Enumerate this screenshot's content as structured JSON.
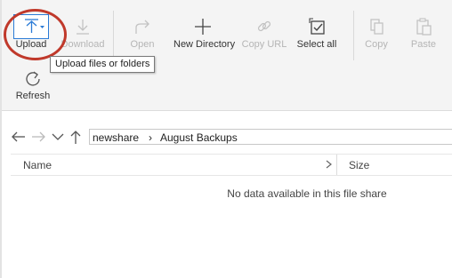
{
  "toolbar": {
    "buttons": [
      {
        "label": "Upload",
        "icon": "upload-icon",
        "enabled": true
      },
      {
        "label": "Download",
        "icon": "download-icon",
        "enabled": false
      },
      {
        "label": "Open",
        "icon": "open-icon",
        "enabled": false
      },
      {
        "label": "New Directory",
        "icon": "plus-icon",
        "enabled": true
      },
      {
        "label": "Copy URL",
        "icon": "link-icon",
        "enabled": false
      },
      {
        "label": "Select all",
        "icon": "select-all-icon",
        "enabled": true
      },
      {
        "label": "Copy",
        "icon": "copy-icon",
        "enabled": false
      },
      {
        "label": "Paste",
        "icon": "paste-icon",
        "enabled": false
      },
      {
        "label": "Refresh",
        "icon": "refresh-icon",
        "enabled": true
      }
    ],
    "tooltip": "Upload files or folders"
  },
  "breadcrumb": {
    "items": [
      "newshare",
      "August Backups"
    ],
    "separator": "›"
  },
  "table": {
    "columns": [
      "Name",
      "Size"
    ],
    "empty_message": "No data available in this file share"
  },
  "colors": {
    "accent": "#2b7bd6",
    "highlight_oval": "#c0392b",
    "disabled_text": "#b5b5b5"
  }
}
